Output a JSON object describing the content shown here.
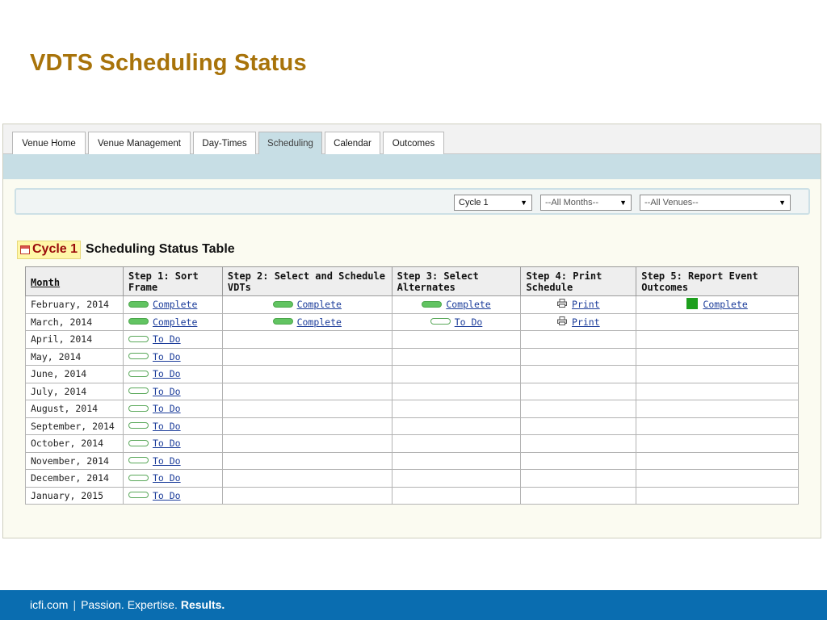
{
  "slide": {
    "title": "VDTS Scheduling Status"
  },
  "tabs": [
    {
      "label": "Venue Home",
      "active": false
    },
    {
      "label": "Venue Management",
      "active": false
    },
    {
      "label": "Day-Times",
      "active": false
    },
    {
      "label": "Scheduling",
      "active": true
    },
    {
      "label": "Calendar",
      "active": false
    },
    {
      "label": "Outcomes",
      "active": false
    }
  ],
  "filters": {
    "cycle": "Cycle 1",
    "months": "--All Months--",
    "venues": "--All Venues--"
  },
  "table_heading": {
    "cycle_badge": "Cycle 1",
    "title": "Scheduling Status Table"
  },
  "table": {
    "columns": [
      "Month",
      "Step 1: Sort Frame",
      "Step 2: Select and Schedule VDTs",
      "Step 3: Select Alternates",
      "Step 4: Print Schedule",
      "Step 5: Report Event Outcomes"
    ],
    "rows": [
      {
        "month": "February, 2014",
        "step1": "Complete",
        "step2": "Complete",
        "step3": "Complete",
        "step4": "Print",
        "step5": "Complete"
      },
      {
        "month": "March, 2014",
        "step1": "Complete",
        "step2": "Complete",
        "step3": "To Do",
        "step4": "Print",
        "step5": ""
      },
      {
        "month": "April, 2014",
        "step1": "To Do",
        "step2": "",
        "step3": "",
        "step4": "",
        "step5": ""
      },
      {
        "month": "May, 2014",
        "step1": "To Do",
        "step2": "",
        "step3": "",
        "step4": "",
        "step5": ""
      },
      {
        "month": "June, 2014",
        "step1": "To Do",
        "step2": "",
        "step3": "",
        "step4": "",
        "step5": ""
      },
      {
        "month": "July, 2014",
        "step1": "To Do",
        "step2": "",
        "step3": "",
        "step4": "",
        "step5": ""
      },
      {
        "month": "August, 2014",
        "step1": "To Do",
        "step2": "",
        "step3": "",
        "step4": "",
        "step5": ""
      },
      {
        "month": "September, 2014",
        "step1": "To Do",
        "step2": "",
        "step3": "",
        "step4": "",
        "step5": ""
      },
      {
        "month": "October, 2014",
        "step1": "To Do",
        "step2": "",
        "step3": "",
        "step4": "",
        "step5": ""
      },
      {
        "month": "November, 2014",
        "step1": "To Do",
        "step2": "",
        "step3": "",
        "step4": "",
        "step5": ""
      },
      {
        "month": "December, 2014",
        "step1": "To Do",
        "step2": "",
        "step3": "",
        "step4": "",
        "step5": ""
      },
      {
        "month": "January, 2015",
        "step1": "To Do",
        "step2": "",
        "step3": "",
        "step4": "",
        "step5": ""
      }
    ]
  },
  "footer": {
    "site": "icfi.com",
    "separator": "|",
    "tagline_1": "Passion.",
    "tagline_2": "Expertise.",
    "tagline_3": "Results."
  },
  "colors": {
    "title": "#a8730a",
    "active_tab": "#c7dee5",
    "complete": "#62c462",
    "link": "#1b3c9a",
    "footer": "#0a6db0"
  },
  "icons": {
    "complete_status": "green-pill-icon",
    "todo_status": "outline-pill-icon",
    "print": "printer-icon",
    "outcome_complete": "green-square-icon",
    "cycle": "calendar-icon"
  }
}
